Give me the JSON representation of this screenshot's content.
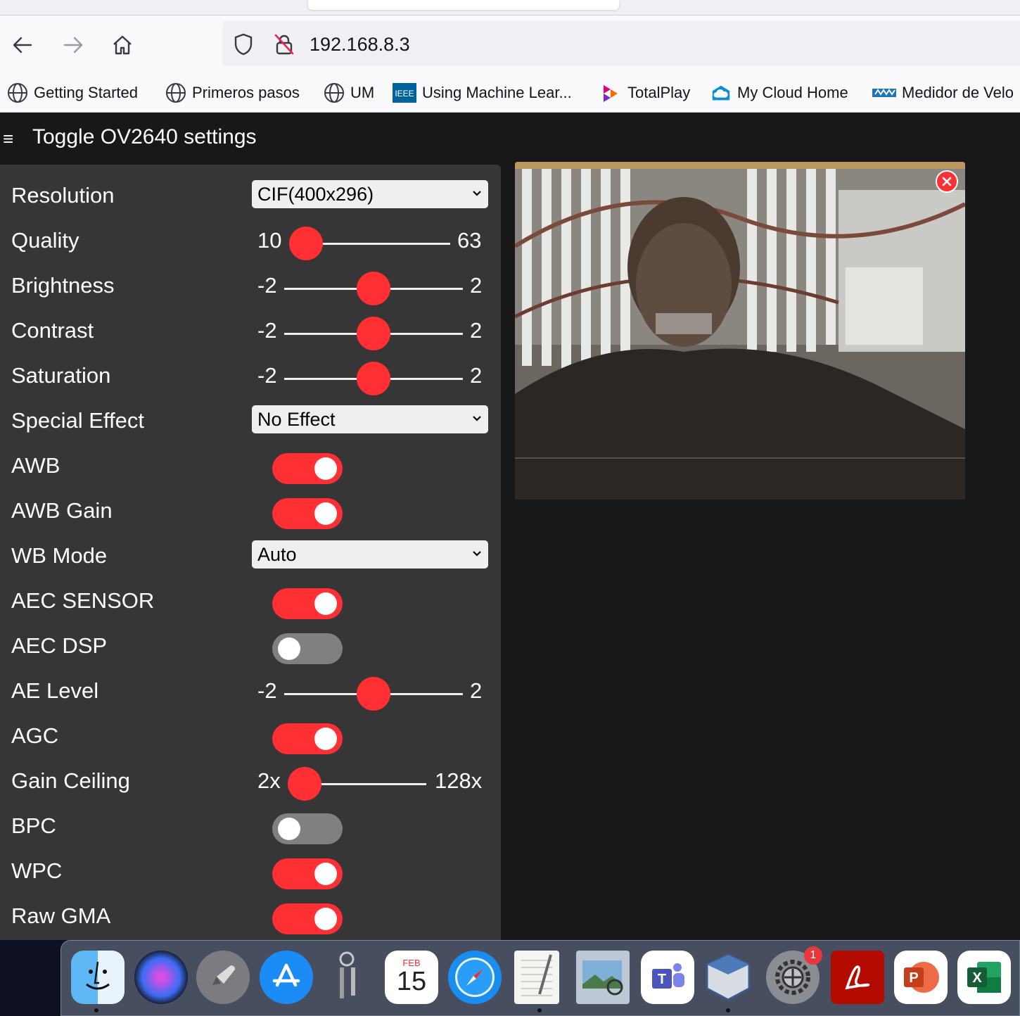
{
  "browser": {
    "url": "192.168.8.3",
    "bookmarks": [
      {
        "label": "Getting Started",
        "icon": "globe-icon"
      },
      {
        "label": "Primeros pasos",
        "icon": "globe-icon"
      },
      {
        "label": "UM",
        "icon": "globe-icon"
      },
      {
        "label": "Using Machine Lear...",
        "icon": "ieee-icon"
      },
      {
        "label": "TotalPlay",
        "icon": "totalplay-icon"
      },
      {
        "label": "My Cloud Home",
        "icon": "cloud-icon"
      },
      {
        "label": "Medidor de Velo",
        "icon": "speedtest-icon"
      }
    ]
  },
  "page": {
    "menu_icon": "≡",
    "title": "Toggle OV2640 settings",
    "controls": {
      "resolution": {
        "label": "Resolution",
        "value": "CIF(400x296)"
      },
      "quality": {
        "label": "Quality",
        "min": "10",
        "max": "63",
        "value": 10
      },
      "brightness": {
        "label": "Brightness",
        "min": "-2",
        "max": "2",
        "value": 0
      },
      "contrast": {
        "label": "Contrast",
        "min": "-2",
        "max": "2",
        "value": 0
      },
      "saturation": {
        "label": "Saturation",
        "min": "-2",
        "max": "2",
        "value": 0
      },
      "special_effect": {
        "label": "Special Effect",
        "value": "No Effect"
      },
      "awb": {
        "label": "AWB",
        "on": true
      },
      "awb_gain": {
        "label": "AWB Gain",
        "on": true
      },
      "wb_mode": {
        "label": "WB Mode",
        "value": "Auto"
      },
      "aec_sensor": {
        "label": "AEC SENSOR",
        "on": true
      },
      "aec_dsp": {
        "label": "AEC DSP",
        "on": false
      },
      "ae_level": {
        "label": "AE Level",
        "min": "-2",
        "max": "2",
        "value": 0
      },
      "agc": {
        "label": "AGC",
        "on": true
      },
      "gain_ceiling": {
        "label": "Gain Ceiling",
        "min": "2x",
        "max": "128x",
        "value": 0
      },
      "bpc": {
        "label": "BPC",
        "on": false
      },
      "wpc": {
        "label": "WPC",
        "on": true
      },
      "raw_gma": {
        "label": "Raw GMA",
        "on": true
      }
    }
  },
  "dock": {
    "calendar": {
      "month": "FEB",
      "day": "15"
    },
    "settings_badge": "1",
    "apps": [
      "finder",
      "siri",
      "launchpad",
      "app-store",
      "keychain",
      "calendar",
      "safari",
      "textedit",
      "preview",
      "teams",
      "virtualbox",
      "system-preferences",
      "acrobat",
      "powerpoint",
      "excel"
    ]
  },
  "colors": {
    "accent": "#ff3034",
    "panel": "#363636",
    "background": "#181818"
  }
}
